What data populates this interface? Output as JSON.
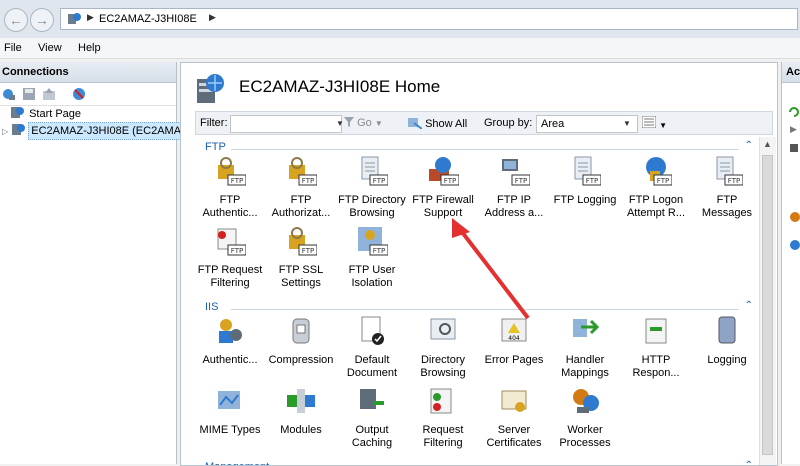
{
  "address": {
    "server": "EC2AMAZ-J3HI08E"
  },
  "menu": [
    "File",
    "View",
    "Help"
  ],
  "connections": {
    "title": "Connections",
    "tree": [
      {
        "label": "Start Page"
      },
      {
        "label": "EC2AMAZ-J3HI08E (EC2AMAZ"
      }
    ]
  },
  "main": {
    "title": "EC2AMAZ-J3HI08E Home",
    "filter_label": "Filter:",
    "go_label": "Go",
    "show_all_label": "Show All",
    "group_by_label": "Group by:",
    "group_by_value": "Area"
  },
  "sections": [
    {
      "title": "FTP",
      "items": [
        {
          "l1": "FTP",
          "l2": "Authentic...",
          "icon": "ftp-authentication-icon"
        },
        {
          "l1": "FTP",
          "l2": "Authorizat...",
          "icon": "ftp-authorization-icon"
        },
        {
          "l1": "FTP Directory",
          "l2": "Browsing",
          "icon": "ftp-directory-browsing-icon"
        },
        {
          "l1": "FTP Firewall",
          "l2": "Support",
          "icon": "ftp-firewall-icon"
        },
        {
          "l1": "FTP IP",
          "l2": "Address a...",
          "icon": "ftp-ip-address-icon"
        },
        {
          "l1": "FTP Logging",
          "l2": "",
          "icon": "ftp-logging-icon"
        },
        {
          "l1": "FTP Logon",
          "l2": "Attempt R...",
          "icon": "ftp-logon-attempt-icon"
        },
        {
          "l1": "FTP",
          "l2": "Messages",
          "icon": "ftp-messages-icon"
        },
        {
          "l1": "FTP Request",
          "l2": "Filtering",
          "icon": "ftp-request-filtering-icon"
        },
        {
          "l1": "FTP SSL",
          "l2": "Settings",
          "icon": "ftp-ssl-icon"
        },
        {
          "l1": "FTP User",
          "l2": "Isolation",
          "icon": "ftp-user-isolation-icon"
        }
      ]
    },
    {
      "title": "IIS",
      "items": [
        {
          "l1": "Authentic...",
          "l2": "",
          "icon": "authentication-icon"
        },
        {
          "l1": "Compression",
          "l2": "",
          "icon": "compression-icon"
        },
        {
          "l1": "Default",
          "l2": "Document",
          "icon": "default-document-icon"
        },
        {
          "l1": "Directory",
          "l2": "Browsing",
          "icon": "directory-browsing-icon"
        },
        {
          "l1": "Error Pages",
          "l2": "",
          "icon": "error-pages-icon"
        },
        {
          "l1": "Handler",
          "l2": "Mappings",
          "icon": "handler-mappings-icon"
        },
        {
          "l1": "HTTP",
          "l2": "Respon...",
          "icon": "http-response-icon"
        },
        {
          "l1": "Logging",
          "l2": "",
          "icon": "logging-icon"
        },
        {
          "l1": "MIME Types",
          "l2": "",
          "icon": "mime-types-icon"
        },
        {
          "l1": "Modules",
          "l2": "",
          "icon": "modules-icon"
        },
        {
          "l1": "Output",
          "l2": "Caching",
          "icon": "output-caching-icon"
        },
        {
          "l1": "Request",
          "l2": "Filtering",
          "icon": "request-filtering-icon"
        },
        {
          "l1": "Server",
          "l2": "Certificates",
          "icon": "server-certificates-icon"
        },
        {
          "l1": "Worker",
          "l2": "Processes",
          "icon": "worker-processes-icon"
        }
      ]
    },
    {
      "title": "Management",
      "items": []
    }
  ],
  "actions": {
    "title": "Ac"
  },
  "colors": {
    "accent": "#1a5fb4",
    "annotation_arrow": "#e53030"
  }
}
